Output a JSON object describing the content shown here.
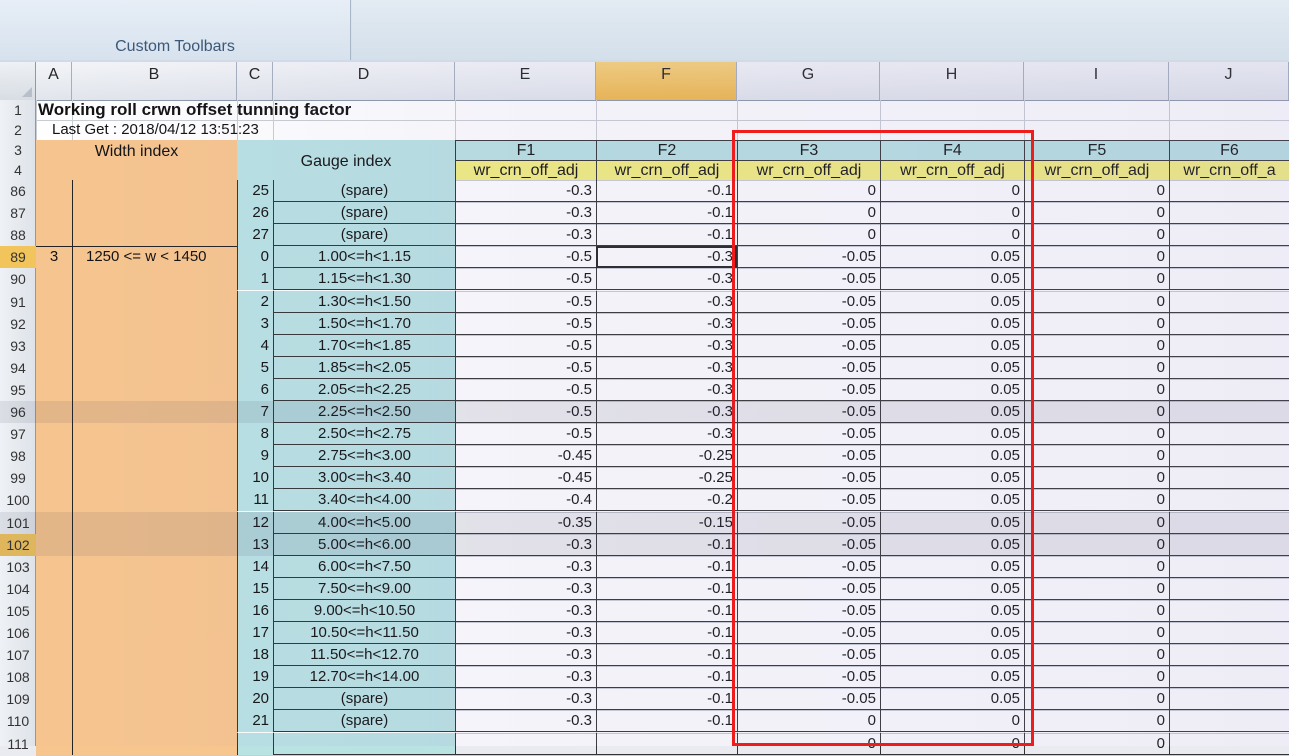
{
  "ribbon": {
    "group_label": "Custom Toolbars"
  },
  "columns": [
    "A",
    "B",
    "C",
    "D",
    "E",
    "F",
    "G",
    "H",
    "I",
    "J"
  ],
  "sheet": {
    "title": "Working roll crwn offset tunning factor",
    "last_get": "Last Get : 2018/04/12 13:51:23",
    "width_index_label": "Width index",
    "gauge_index_label": "Gauge index",
    "group_index": "3",
    "group_range": "1250 <= w < 1450",
    "stands": [
      "F1",
      "F2",
      "F3",
      "F4",
      "F5",
      "F6"
    ],
    "param_labels": [
      "wr_crn_off_adj",
      "wr_crn_off_adj",
      "wr_crn_off_adj",
      "wr_crn_off_adj",
      "wr_crn_off_adj",
      "wr_crn_off_a"
    ],
    "top_rows": [
      "1",
      "2",
      "3",
      "4"
    ],
    "rows": [
      {
        "row": "86",
        "c": "25",
        "d": "(spare)",
        "e": "-0.3",
        "f": "-0.1",
        "g": "0",
        "h": "0",
        "i": "0",
        "j": ""
      },
      {
        "row": "87",
        "c": "26",
        "d": "(spare)",
        "e": "-0.3",
        "f": "-0.1",
        "g": "0",
        "h": "0",
        "i": "0",
        "j": ""
      },
      {
        "row": "88",
        "c": "27",
        "d": "(spare)",
        "e": "-0.3",
        "f": "-0.1",
        "g": "0",
        "h": "0",
        "i": "0",
        "j": ""
      },
      {
        "row": "89",
        "c": "0",
        "d": "1.00<=h<1.15",
        "e": "-0.5",
        "f": "-0.3",
        "g": "-0.05",
        "h": "0.05",
        "i": "0",
        "j": ""
      },
      {
        "row": "90",
        "c": "1",
        "d": "1.15<=h<1.30",
        "e": "-0.5",
        "f": "-0.3",
        "g": "-0.05",
        "h": "0.05",
        "i": "0",
        "j": ""
      },
      {
        "row": "91",
        "c": "2",
        "d": "1.30<=h<1.50",
        "e": "-0.5",
        "f": "-0.3",
        "g": "-0.05",
        "h": "0.05",
        "i": "0",
        "j": ""
      },
      {
        "row": "92",
        "c": "3",
        "d": "1.50<=h<1.70",
        "e": "-0.5",
        "f": "-0.3",
        "g": "-0.05",
        "h": "0.05",
        "i": "0",
        "j": ""
      },
      {
        "row": "93",
        "c": "4",
        "d": "1.70<=h<1.85",
        "e": "-0.5",
        "f": "-0.3",
        "g": "-0.05",
        "h": "0.05",
        "i": "0",
        "j": ""
      },
      {
        "row": "94",
        "c": "5",
        "d": "1.85<=h<2.05",
        "e": "-0.5",
        "f": "-0.3",
        "g": "-0.05",
        "h": "0.05",
        "i": "0",
        "j": ""
      },
      {
        "row": "95",
        "c": "6",
        "d": "2.05<=h<2.25",
        "e": "-0.5",
        "f": "-0.3",
        "g": "-0.05",
        "h": "0.05",
        "i": "0",
        "j": ""
      },
      {
        "row": "96",
        "c": "7",
        "d": "2.25<=h<2.50",
        "e": "-0.5",
        "f": "-0.3",
        "g": "-0.05",
        "h": "0.05",
        "i": "0",
        "j": ""
      },
      {
        "row": "97",
        "c": "8",
        "d": "2.50<=h<2.75",
        "e": "-0.5",
        "f": "-0.3",
        "g": "-0.05",
        "h": "0.05",
        "i": "0",
        "j": ""
      },
      {
        "row": "98",
        "c": "9",
        "d": "2.75<=h<3.00",
        "e": "-0.45",
        "f": "-0.25",
        "g": "-0.05",
        "h": "0.05",
        "i": "0",
        "j": ""
      },
      {
        "row": "99",
        "c": "10",
        "d": "3.00<=h<3.40",
        "e": "-0.45",
        "f": "-0.25",
        "g": "-0.05",
        "h": "0.05",
        "i": "0",
        "j": ""
      },
      {
        "row": "100",
        "c": "11",
        "d": "3.40<=h<4.00",
        "e": "-0.4",
        "f": "-0.2",
        "g": "-0.05",
        "h": "0.05",
        "i": "0",
        "j": ""
      },
      {
        "row": "101",
        "c": "12",
        "d": "4.00<=h<5.00",
        "e": "-0.35",
        "f": "-0.15",
        "g": "-0.05",
        "h": "0.05",
        "i": "0",
        "j": ""
      },
      {
        "row": "102",
        "c": "13",
        "d": "5.00<=h<6.00",
        "e": "-0.3",
        "f": "-0.1",
        "g": "-0.05",
        "h": "0.05",
        "i": "0",
        "j": ""
      },
      {
        "row": "103",
        "c": "14",
        "d": "6.00<=h<7.50",
        "e": "-0.3",
        "f": "-0.1",
        "g": "-0.05",
        "h": "0.05",
        "i": "0",
        "j": ""
      },
      {
        "row": "104",
        "c": "15",
        "d": "7.50<=h<9.00",
        "e": "-0.3",
        "f": "-0.1",
        "g": "-0.05",
        "h": "0.05",
        "i": "0",
        "j": ""
      },
      {
        "row": "105",
        "c": "16",
        "d": "9.00<=h<10.50",
        "e": "-0.3",
        "f": "-0.1",
        "g": "-0.05",
        "h": "0.05",
        "i": "0",
        "j": ""
      },
      {
        "row": "106",
        "c": "17",
        "d": "10.50<=h<11.50",
        "e": "-0.3",
        "f": "-0.1",
        "g": "-0.05",
        "h": "0.05",
        "i": "0",
        "j": ""
      },
      {
        "row": "107",
        "c": "18",
        "d": "11.50<=h<12.70",
        "e": "-0.3",
        "f": "-0.1",
        "g": "-0.05",
        "h": "0.05",
        "i": "0",
        "j": ""
      },
      {
        "row": "108",
        "c": "19",
        "d": "12.70<=h<14.00",
        "e": "-0.3",
        "f": "-0.1",
        "g": "-0.05",
        "h": "0.05",
        "i": "0",
        "j": ""
      },
      {
        "row": "109",
        "c": "20",
        "d": "(spare)",
        "e": "-0.3",
        "f": "-0.1",
        "g": "-0.05",
        "h": "0.05",
        "i": "0",
        "j": ""
      },
      {
        "row": "110",
        "c": "21",
        "d": "(spare)",
        "e": "-0.3",
        "f": "-0.1",
        "g": "0",
        "h": "0",
        "i": "0",
        "j": ""
      },
      {
        "row": "111",
        "c": "",
        "d": "",
        "e": "",
        "f": "",
        "g": "0",
        "h": "0",
        "i": "0",
        "j": ""
      }
    ]
  },
  "colors": {
    "orange_fill": "#f7c58e",
    "teal_fill": "#b9e2e3",
    "yellow_fill": "#f3ef7e",
    "selection_header": "#f2c45c",
    "highlight_box": "#ee1c1c"
  }
}
